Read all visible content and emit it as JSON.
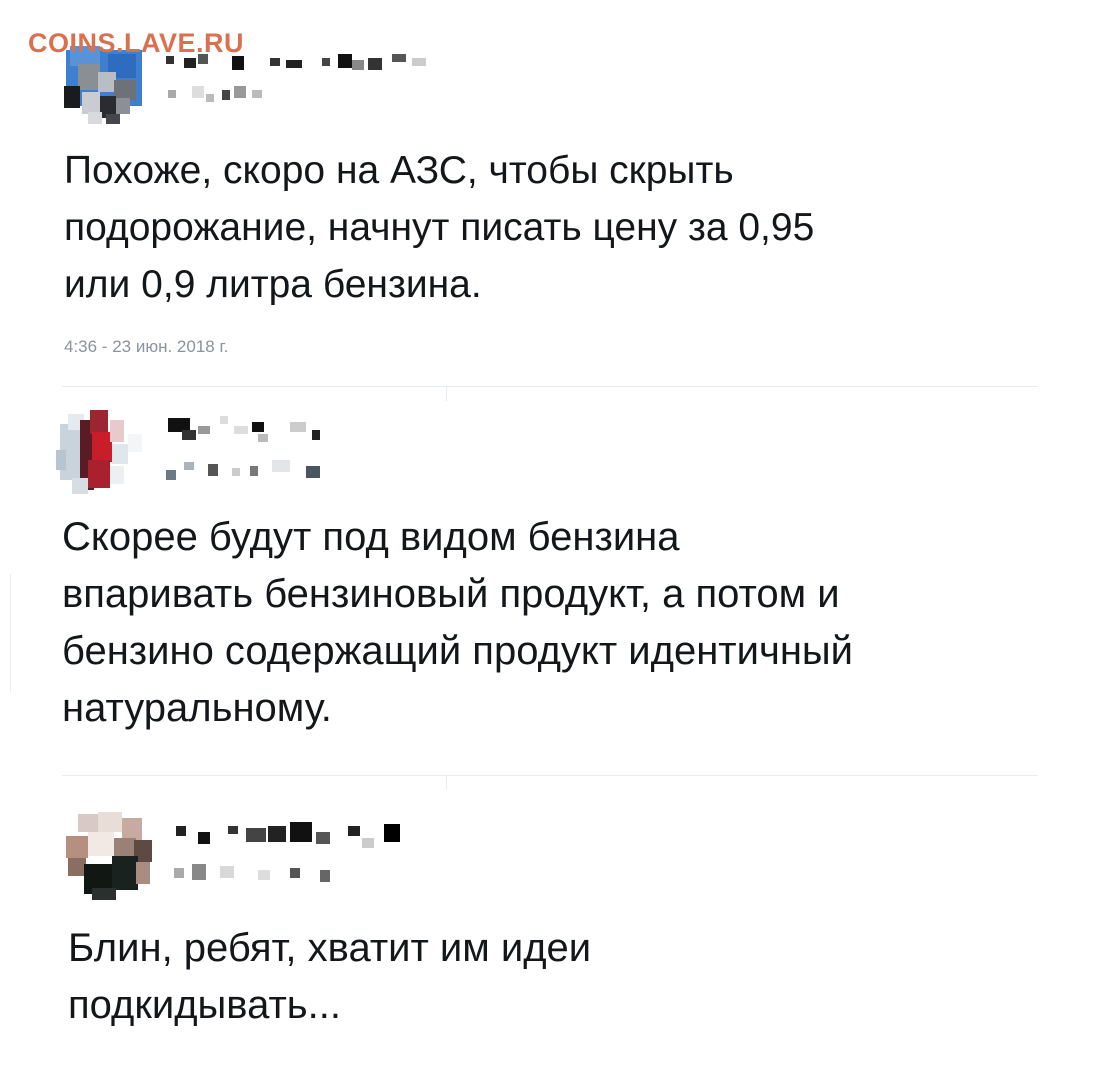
{
  "watermark": "COINS.LAVE.RU",
  "tweets": [
    {
      "text": "Похоже, скоро на АЗС, чтобы скрыть\nподорожание, начнут писать цену за 0,95\nили 0,9 литра бензина.",
      "timestamp": "4:36 - 23 июн. 2018 г."
    },
    {
      "text": "Скорее будут под видом бензина\nвпаривать бензиновый продукт, а потом и\nбензино содержащий продукт идентичный\nнатуральному."
    },
    {
      "text": "Блин, ребят, хватит им идеи\nподкидывать..."
    }
  ]
}
